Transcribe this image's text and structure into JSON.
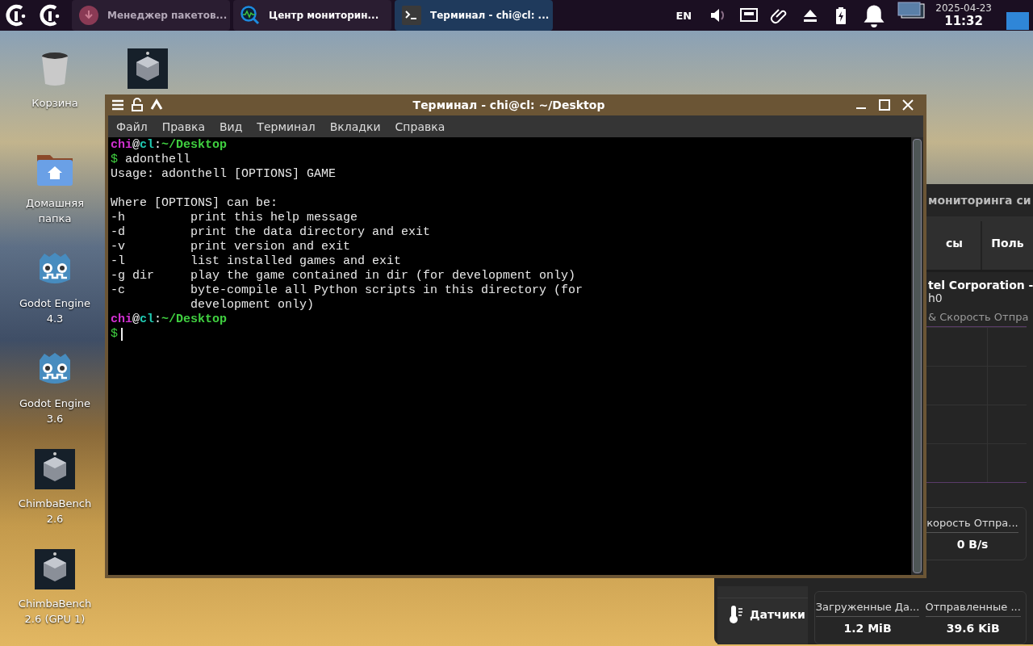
{
  "taskbar": {
    "tasks": [
      {
        "kind": "packages",
        "label": "Менеджер пакетов...",
        "selected": false,
        "minimized": true
      },
      {
        "kind": "monitor",
        "label": "Центр мониторин...",
        "selected": false,
        "minimized": false
      },
      {
        "kind": "terminal",
        "label": "Терминал - chi@cl: ...",
        "selected": true,
        "minimized": false
      }
    ],
    "language": "EN",
    "date": "2025-04-23",
    "time": "11:32"
  },
  "desktop_icons": [
    {
      "kind": "trash",
      "label_lines": [
        "Корзина"
      ]
    },
    {
      "kind": "home",
      "label_lines": [
        "Домашняя",
        "папка"
      ]
    },
    {
      "kind": "godot",
      "label_lines": [
        "Godot Engine",
        "4.3"
      ]
    },
    {
      "kind": "godot",
      "label_lines": [
        "Godot Engine",
        "3.6"
      ]
    },
    {
      "kind": "cube",
      "label_lines": [
        "ChimbaBench",
        "2.6"
      ]
    },
    {
      "kind": "cube",
      "label_lines": [
        "ChimbaBench",
        "2.6 (GPU 1)"
      ]
    }
  ],
  "monitor_window": {
    "title": "мониторинга си",
    "tabs": [
      "сы",
      "Поль"
    ],
    "device": "tel Corporation -",
    "interface": "h0",
    "graph_legend": "& Скорость Отпра",
    "cards": [
      {
        "items": [
          {
            "label": "корость Отпра...",
            "value": "0 B/s"
          }
        ]
      },
      {
        "items": [
          {
            "label": "Загруженные Да...",
            "value": "1.2 MiB"
          },
          {
            "label": "Отправленные ...",
            "value": "39.6 KiB"
          }
        ]
      }
    ],
    "sidebar": [
      {
        "kind": "partial"
      },
      {
        "kind": "sensors",
        "label": "Датчики"
      }
    ]
  },
  "terminal": {
    "title": "Терминал - chi@cl: ~/Desktop",
    "menu": [
      "Файл",
      "Правка",
      "Вид",
      "Терминал",
      "Вкладки",
      "Справка"
    ],
    "lines": [
      {
        "kind": "prompt",
        "user": "chi",
        "at": "@",
        "host": "cl",
        "sep": ":",
        "path": "~/Desktop"
      },
      {
        "kind": "command",
        "symbol": "$",
        "text": "adonthell"
      },
      {
        "kind": "output",
        "text": "Usage: adonthell [OPTIONS] GAME"
      },
      {
        "kind": "blank"
      },
      {
        "kind": "output",
        "text": "Where [OPTIONS] can be:"
      },
      {
        "kind": "output",
        "text": "-h         print this help message"
      },
      {
        "kind": "output",
        "text": "-d         print the data directory and exit"
      },
      {
        "kind": "output",
        "text": "-v         print version and exit"
      },
      {
        "kind": "output",
        "text": "-l         list installed games and exit"
      },
      {
        "kind": "output",
        "text": "-g dir     play the game contained in dir (for development only)"
      },
      {
        "kind": "output",
        "text": "-c         byte-compile all Python scripts in this directory (for"
      },
      {
        "kind": "output",
        "text": "           development only)"
      },
      {
        "kind": "prompt",
        "user": "chi",
        "at": "@",
        "host": "cl",
        "sep": ":",
        "path": "~/Desktop"
      },
      {
        "kind": "command",
        "symbol": "$",
        "cursor": true
      }
    ]
  }
}
